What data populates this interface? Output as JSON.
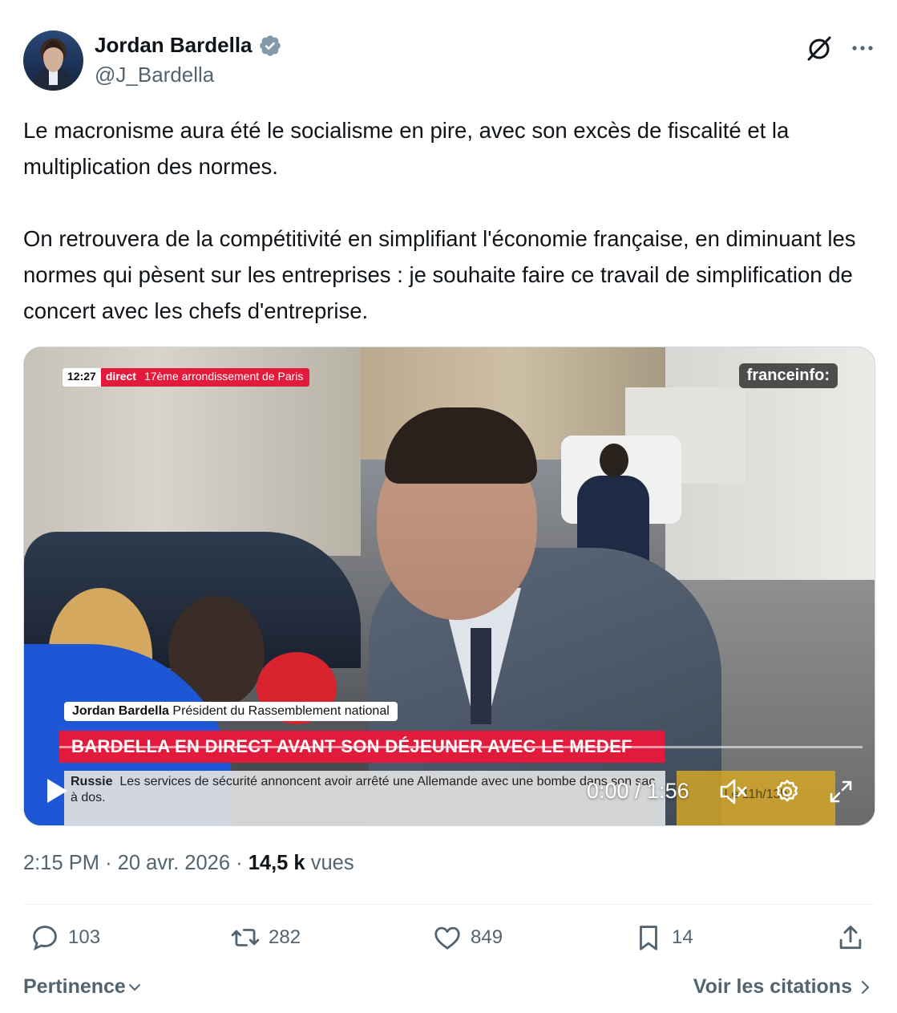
{
  "author": {
    "name": "Jordan Bardella",
    "handle": "@J_Bardella",
    "verified_color": "#829aab"
  },
  "tweet": {
    "paragraph1": "Le macronisme aura été le socialisme en pire, avec son excès de fiscalité et la multiplication des normes.",
    "paragraph2": "On retrouvera de la compétitivité en simplifiant l'économie française, en diminuant les normes qui pèsent sur les entreprises : je souhaite faire ce travail de simplification de concert avec les chefs d'entreprise."
  },
  "video": {
    "overlay_time": "12:27",
    "overlay_live": "direct",
    "overlay_location": "17ème arrondissement de Paris",
    "channel": "franceinfo:",
    "lower_third_name": "Jordan Bardella",
    "lower_third_title": "Président du Rassemblement national",
    "headline": "BARDELLA EN DIRECT AVANT SON DÉJEUNER AVEC LE MEDEF",
    "ticker_label": "Russie",
    "ticker_text": "Les services de sécurité annoncent avoir arrêté une Allemande avec une bombe dans son sac à dos.",
    "ticker_right": "Le 11h/13h",
    "player_time": "0:00 / 1:56",
    "progress": 0
  },
  "meta": {
    "time": "2:15 PM",
    "separator": "·",
    "date": "20 avr. 2026",
    "views_count": "14,5 k",
    "views_label": "vues"
  },
  "actions": {
    "replies": "103",
    "reposts": "282",
    "likes": "849",
    "bookmarks": "14"
  },
  "footer": {
    "sort_label": "Pertinence",
    "quotes_label": "Voir les citations"
  },
  "icons": [
    "verified-badge-icon",
    "grok-icon",
    "more-icon",
    "play-icon",
    "volume-icon",
    "settings-icon",
    "fullscreen-icon",
    "reply-icon",
    "repost-icon",
    "like-icon",
    "bookmark-icon",
    "share-icon",
    "chevron-down-icon",
    "chevron-right-icon"
  ],
  "colors": {
    "text": "#0f1419",
    "secondary": "#536471",
    "news_red": "#e21a3c"
  }
}
